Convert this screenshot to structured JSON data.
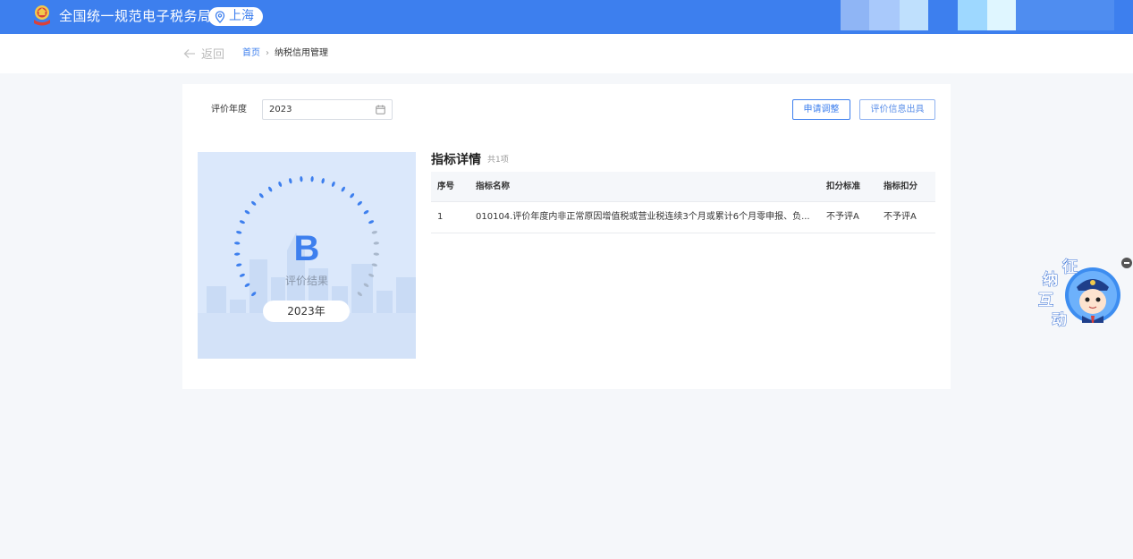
{
  "header": {
    "site_title": "全国统一规范电子税务局",
    "region": "上海",
    "mosaic_colors": [
      "#8fb5f5",
      "#a9c9fb",
      "#bfe0fd",
      "#3d7fee",
      "#9ed8ff",
      "#dff6ff",
      "#4f8df0"
    ]
  },
  "nav": {
    "back_label": "返回",
    "breadcrumb_home": "首页",
    "breadcrumb_separator": "›",
    "breadcrumb_current": "纳税信用管理"
  },
  "filter": {
    "year_label": "评价年度",
    "year_value": "2023"
  },
  "actions": {
    "apply_adjust": "申请调整",
    "issue_info": "评价信息出具"
  },
  "result": {
    "grade": "B",
    "label": "评价结果",
    "year": "2023年"
  },
  "detail": {
    "title": "指标详情",
    "count": "共1项",
    "columns": [
      "序号",
      "指标名称",
      "扣分标准",
      "指标扣分"
    ],
    "rows": [
      [
        "1",
        "010104.评价年度内非正常原因增值税或营业税连续3个月或累计6个月零申报、负...",
        "不予评A",
        "不予评A"
      ]
    ]
  },
  "assistant": {
    "chars": [
      "征",
      "纳",
      "互",
      "动"
    ]
  },
  "colors": {
    "brand": "#3d7fee",
    "page_bg": "#f5f7fa"
  }
}
